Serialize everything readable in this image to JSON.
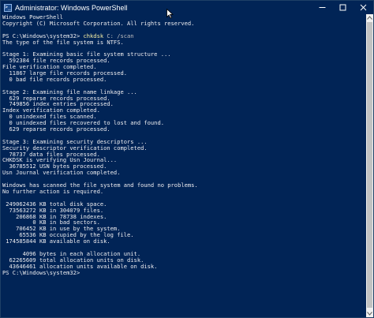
{
  "window": {
    "title": "Administrator: Windows PowerShell",
    "icon_glyph": ">_",
    "controls": [
      "minimize-icon",
      "maximize-icon",
      "close-icon"
    ]
  },
  "console": {
    "lines": [
      {
        "text": "Windows PowerShell"
      },
      {
        "text": "Copyright (C) Microsoft Corporation. All rights reserved."
      },
      {
        "text": ""
      },
      {
        "prompt": "PS C:\\Windows\\system32> ",
        "command": "chkdsk",
        "args": " C: /scan"
      },
      {
        "text": "The type of the file system is NTFS."
      },
      {
        "text": ""
      },
      {
        "text": "Stage 1: Examining basic file system structure ..."
      },
      {
        "text": "  592384 file records processed."
      },
      {
        "text": "File verification completed."
      },
      {
        "text": "  11867 large file records processed."
      },
      {
        "text": "  0 bad file records processed."
      },
      {
        "text": ""
      },
      {
        "text": "Stage 2: Examining file name linkage ..."
      },
      {
        "text": "  629 reparse records processed."
      },
      {
        "text": "  749856 index entries processed."
      },
      {
        "text": "Index verification completed."
      },
      {
        "text": "  0 unindexed files scanned."
      },
      {
        "text": "  0 unindexed files recovered to lost and found."
      },
      {
        "text": "  629 reparse records processed."
      },
      {
        "text": ""
      },
      {
        "text": "Stage 3: Examining security descriptors ..."
      },
      {
        "text": "Security descriptor verification completed."
      },
      {
        "text": "  78737 data files processed."
      },
      {
        "text": "CHKDSK is verifying Usn Journal..."
      },
      {
        "text": "  36785512 USN bytes processed."
      },
      {
        "text": "Usn Journal verification completed."
      },
      {
        "text": ""
      },
      {
        "text": "Windows has scanned the file system and found no problems."
      },
      {
        "text": "No further action is required."
      },
      {
        "text": ""
      },
      {
        "text": " 249062436 KB total disk space."
      },
      {
        "text": "  73563272 KB in 304079 files."
      },
      {
        "text": "    206868 KB in 78738 indexes."
      },
      {
        "text": "         0 KB in bad sectors."
      },
      {
        "text": "    706452 KB in use by the system."
      },
      {
        "text": "     65536 KB occupied by the log file."
      },
      {
        "text": " 174585844 KB available on disk."
      },
      {
        "text": ""
      },
      {
        "text": "      4096 bytes in each allocation unit."
      },
      {
        "text": "  62265609 total allocation units on disk."
      },
      {
        "text": "  43646461 allocation units available on disk."
      },
      {
        "text": "PS C:\\Windows\\system32>"
      }
    ]
  },
  "colors": {
    "background": "#012456",
    "text": "#eeedf0",
    "command": "#f9f1a5",
    "scrollbar_track": "#f0f0f0",
    "scrollbar_thumb": "#c2c2c2"
  }
}
